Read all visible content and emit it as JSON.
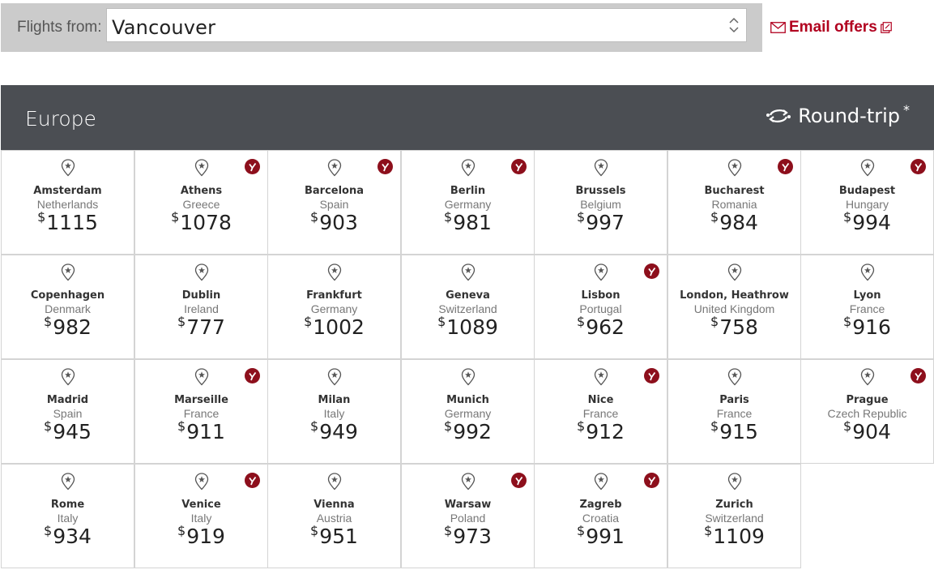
{
  "search": {
    "label": "Flights from:",
    "city": "Vancouver"
  },
  "email_offers": {
    "label": "Email offers"
  },
  "header": {
    "region": "Europe",
    "trip_type": "Round-trip",
    "asterisk": "*"
  },
  "colors": {
    "brand": "#b1001f",
    "header_bg": "#4b4e53",
    "topbar_bg": "#cbcbcb"
  },
  "currency_symbol": "$",
  "destinations": [
    {
      "city": "Amsterdam",
      "country": "Netherlands",
      "price": "1115",
      "badge": false
    },
    {
      "city": "Athens",
      "country": "Greece",
      "price": "1078",
      "badge": true
    },
    {
      "city": "Barcelona",
      "country": "Spain",
      "price": "903",
      "badge": true
    },
    {
      "city": "Berlin",
      "country": "Germany",
      "price": "981",
      "badge": true
    },
    {
      "city": "Brussels",
      "country": "Belgium",
      "price": "997",
      "badge": false
    },
    {
      "city": "Bucharest",
      "country": "Romania",
      "price": "984",
      "badge": true
    },
    {
      "city": "Budapest",
      "country": "Hungary",
      "price": "994",
      "badge": true
    },
    {
      "city": "Copenhagen",
      "country": "Denmark",
      "price": "982",
      "badge": false
    },
    {
      "city": "Dublin",
      "country": "Ireland",
      "price": "777",
      "badge": false
    },
    {
      "city": "Frankfurt",
      "country": "Germany",
      "price": "1002",
      "badge": false
    },
    {
      "city": "Geneva",
      "country": "Switzerland",
      "price": "1089",
      "badge": false
    },
    {
      "city": "Lisbon",
      "country": "Portugal",
      "price": "962",
      "badge": true
    },
    {
      "city": "London, Heathrow",
      "country": "United Kingdom",
      "price": "758",
      "badge": false
    },
    {
      "city": "Lyon",
      "country": "France",
      "price": "916",
      "badge": false
    },
    {
      "city": "Madrid",
      "country": "Spain",
      "price": "945",
      "badge": false
    },
    {
      "city": "Marseille",
      "country": "France",
      "price": "911",
      "badge": true
    },
    {
      "city": "Milan",
      "country": "Italy",
      "price": "949",
      "badge": false
    },
    {
      "city": "Munich",
      "country": "Germany",
      "price": "992",
      "badge": false
    },
    {
      "city": "Nice",
      "country": "France",
      "price": "912",
      "badge": true
    },
    {
      "city": "Paris",
      "country": "France",
      "price": "915",
      "badge": false
    },
    {
      "city": "Prague",
      "country": "Czech Republic",
      "price": "904",
      "badge": true
    },
    {
      "city": "Rome",
      "country": "Italy",
      "price": "934",
      "badge": false
    },
    {
      "city": "Venice",
      "country": "Italy",
      "price": "919",
      "badge": true
    },
    {
      "city": "Vienna",
      "country": "Austria",
      "price": "951",
      "badge": false
    },
    {
      "city": "Warsaw",
      "country": "Poland",
      "price": "973",
      "badge": true
    },
    {
      "city": "Zagreb",
      "country": "Croatia",
      "price": "991",
      "badge": true
    },
    {
      "city": "Zurich",
      "country": "Switzerland",
      "price": "1109",
      "badge": false
    }
  ]
}
